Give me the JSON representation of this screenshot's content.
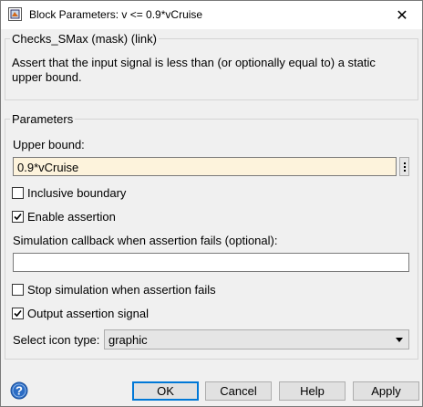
{
  "window": {
    "title": "Block Parameters: v <= 0.9*vCruise",
    "close_glyph": "✕"
  },
  "mask_group": {
    "legend": "Checks_SMax (mask) (link)",
    "description_line1": "Assert that the input signal is less than (or optionally equal to) a static",
    "description_line2": "upper bound."
  },
  "parameters": {
    "legend": "Parameters",
    "upper_bound_label": "Upper bound:",
    "upper_bound_value": "0.9*vCruise",
    "inclusive_boundary": {
      "label": "Inclusive boundary",
      "checked": false
    },
    "enable_assertion": {
      "label": "Enable assertion",
      "checked": true
    },
    "callback_label": "Simulation callback when assertion fails (optional):",
    "callback_value": "",
    "stop_simulation": {
      "label": "Stop simulation when assertion fails",
      "checked": false
    },
    "output_assertion": {
      "label": "Output assertion signal",
      "checked": true
    },
    "icon_type_label": "Select icon type:",
    "icon_type_value": "graphic"
  },
  "buttons": {
    "ok": "OK",
    "cancel": "Cancel",
    "help": "Help",
    "apply": "Apply"
  },
  "colors": {
    "highlight_field": "#fdf3dc",
    "default_button_border": "#0078d7",
    "help_icon": "#2b6cc4"
  }
}
